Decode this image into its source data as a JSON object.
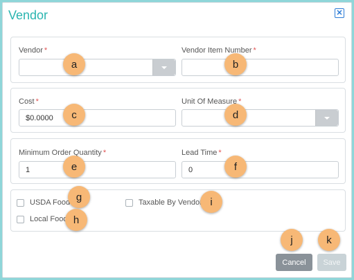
{
  "dialog": {
    "title": "Vendor",
    "close_icon": "close-icon"
  },
  "fields": {
    "vendor": {
      "label": "Vendor",
      "required": "*",
      "value": ""
    },
    "vendor_item_number": {
      "label": "Vendor Item Number",
      "required": "*",
      "value": ""
    },
    "cost": {
      "label": "Cost",
      "required": "*",
      "value": "$0.0000"
    },
    "unit_of_measure": {
      "label": "Unit Of Measure",
      "required": "*",
      "value": ""
    },
    "minimum_order_quantity": {
      "label": "Minimum Order Quantity",
      "required": "*",
      "value": "1"
    },
    "lead_time": {
      "label": "Lead Time",
      "required": "*",
      "value": "0"
    }
  },
  "checkboxes": {
    "usda_food": {
      "label": "USDA Food",
      "checked": false
    },
    "local_food": {
      "label": "Local Food",
      "checked": false
    },
    "taxable_by_vendor": {
      "label": "Taxable By Vendor",
      "checked": false
    }
  },
  "buttons": {
    "cancel": "Cancel",
    "save": "Save"
  },
  "markers": {
    "a": "a",
    "b": "b",
    "c": "c",
    "d": "d",
    "e": "e",
    "f": "f",
    "g": "g",
    "h": "h",
    "i": "i",
    "j": "j",
    "k": "k"
  },
  "colors": {
    "accent": "#2bb5b0",
    "required": "#e05252",
    "marker": "#f7b876",
    "cancel_bg": "#8a9299",
    "save_bg_disabled": "#c9d3d7"
  }
}
